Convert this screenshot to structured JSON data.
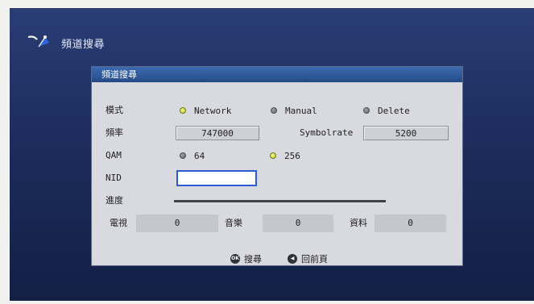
{
  "header": {
    "title": "頻道搜尋",
    "logo_icon": "satellite-dish-icon"
  },
  "dialog": {
    "title": "頻道搜尋",
    "mode": {
      "label": "模式",
      "options": [
        "Network",
        "Manual",
        "Delete"
      ],
      "selected": "Network"
    },
    "frequency": {
      "label": "頻率",
      "value": "747000"
    },
    "symbolrate": {
      "label": "Symbolrate",
      "value": "5200"
    },
    "qam": {
      "label": "QAM",
      "options": [
        "64",
        "256"
      ],
      "selected": "256"
    },
    "nid": {
      "label": "NID",
      "value": ""
    },
    "progress": {
      "label": "進度",
      "percent": 100
    },
    "stats": [
      {
        "label": "電視",
        "value": "0"
      },
      {
        "label": "音樂",
        "value": "0"
      },
      {
        "label": "資料",
        "value": "0"
      }
    ],
    "footer": {
      "ok_icon_text": "OK",
      "ok_label": "搜尋",
      "back_label": "回前頁"
    }
  },
  "colors": {
    "background": "#1c2c5c",
    "title_bar": "#2e5a9c",
    "dialog": "#d9dadf",
    "selected_radio": "#c8d43a",
    "focus_border": "#2c5bd6"
  }
}
